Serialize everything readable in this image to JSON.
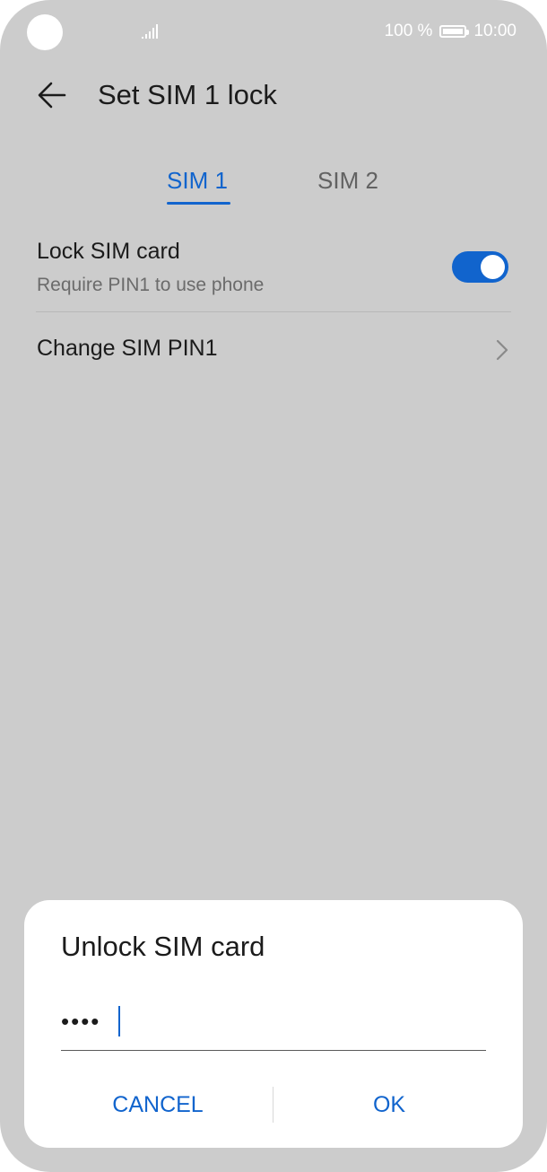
{
  "status_bar": {
    "battery_text": "100 %",
    "time": "10:00",
    "icons": [
      "camera-cutout",
      "signal-icon",
      "battery-icon"
    ]
  },
  "header": {
    "back_icon": "arrow-left-icon",
    "title": "Set SIM 1 lock"
  },
  "tabs": [
    {
      "label": "SIM 1",
      "selected": true
    },
    {
      "label": "SIM 2",
      "selected": false
    }
  ],
  "settings": {
    "lock_sim": {
      "title": "Lock SIM card",
      "subtitle": "Require PIN1 to use phone",
      "enabled": true
    },
    "change_pin": {
      "title": "Change SIM PIN1",
      "icon": "chevron-right-icon"
    }
  },
  "dialog": {
    "title": "Unlock SIM card",
    "pin_masked": "••••",
    "cancel_label": "CANCEL",
    "ok_label": "OK"
  },
  "colors": {
    "accent": "#1164cd",
    "scrim_background": "#cccccc",
    "dialog_background": "#ffffff"
  }
}
